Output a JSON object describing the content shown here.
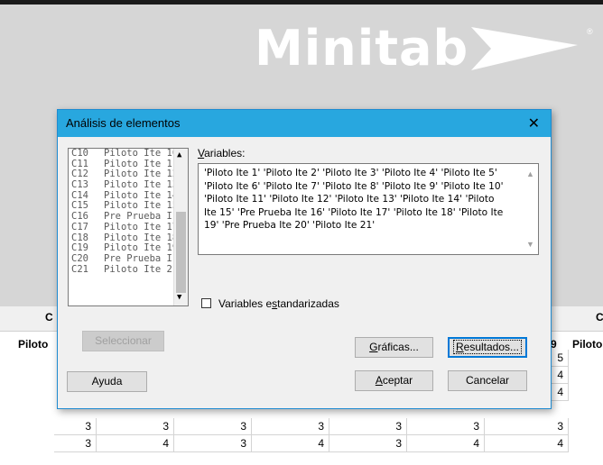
{
  "app": {
    "logo_text": "Minitab",
    "logo_mark": "play-arrow-logo"
  },
  "worksheet": {
    "partial_headers": [
      {
        "key": "left_c",
        "text": "C"
      },
      {
        "key": "left_piloto",
        "text": "Piloto"
      },
      {
        "key": "right_e9",
        "text": "e 9"
      },
      {
        "key": "right_piloto",
        "text": "Piloto"
      },
      {
        "key": "right_c",
        "text": "C"
      }
    ],
    "right_column_values": [
      "5",
      "4",
      "4"
    ],
    "rows": [
      [
        "3",
        "3",
        "3",
        "3",
        "3",
        "3",
        "3"
      ],
      [
        "3",
        "4",
        "3",
        "4",
        "3",
        "4",
        "4"
      ]
    ]
  },
  "dialog": {
    "title": "Análisis de elementos",
    "close_icon": "close-icon",
    "variable_list": [
      {
        "id": "C10",
        "name": "Piloto Ite 10"
      },
      {
        "id": "C11",
        "name": "Piloto Ite 11"
      },
      {
        "id": "C12",
        "name": "Piloto Ite 12"
      },
      {
        "id": "C13",
        "name": "Piloto Ite 13"
      },
      {
        "id": "C14",
        "name": "Piloto Ite 14"
      },
      {
        "id": "C15",
        "name": "Piloto Ite 15"
      },
      {
        "id": "C16",
        "name": "Pre Prueba I"
      },
      {
        "id": "C17",
        "name": "Piloto Ite 17"
      },
      {
        "id": "C18",
        "name": "Piloto Ite 18"
      },
      {
        "id": "C19",
        "name": "Piloto Ite 19"
      },
      {
        "id": "C20",
        "name": "Pre Prueba I"
      },
      {
        "id": "C21",
        "name": "Piloto Ite 21"
      }
    ],
    "variables_label_pre": "",
    "variables_label_u": "V",
    "variables_label_post": "ariables:",
    "variables_value": "'Piloto Ite 1' 'Piloto Ite 2' 'Piloto Ite 3' 'Piloto Ite 4' 'Piloto Ite 5' 'Piloto Ite 6' 'Piloto Ite 7' 'Piloto Ite 8' 'Piloto Ite 9' 'Piloto Ite 10' 'Piloto Ite 11' 'Piloto Ite 12' 'Piloto Ite 13' 'Piloto Ite 14' 'Piloto Ite 15' 'Pre Prueba Ite 16' 'Piloto Ite 17' 'Piloto Ite 18' 'Piloto Ite 19' 'Pre Prueba Ite 20' 'Piloto Ite 21'",
    "standardized_pre": "Variables e",
    "standardized_u": "s",
    "standardized_post": "tandarizadas",
    "standardized_checked": false,
    "buttons": {
      "select": "Seleccionar",
      "help": "Ayuda",
      "graphs_u": "G",
      "graphs_post": "ráficas...",
      "results_u": "R",
      "results_post": "esultados...",
      "ok_u": "A",
      "ok_post": "ceptar",
      "cancel": "Cancelar"
    }
  }
}
